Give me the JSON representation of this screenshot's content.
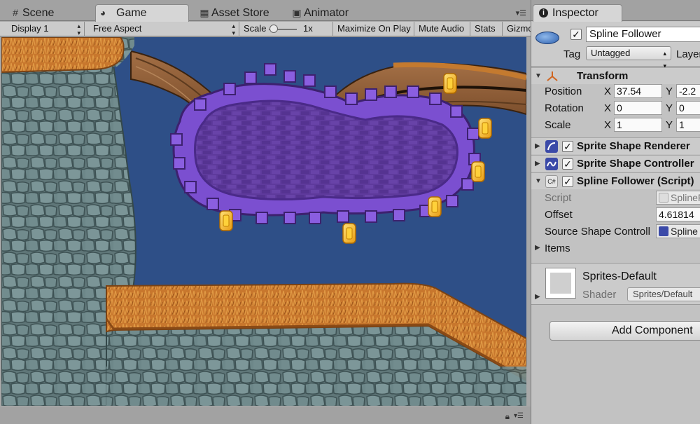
{
  "tabs": [
    {
      "label": "Scene",
      "icon": "grid-icon"
    },
    {
      "label": "Game",
      "icon": "pacman-icon"
    },
    {
      "label": "Asset Store",
      "icon": "store-icon"
    },
    {
      "label": "Animator",
      "icon": "animator-icon"
    }
  ],
  "toolbar": {
    "display": "Display 1",
    "aspect": "Free Aspect",
    "scale_label": "Scale",
    "scale_value": "1x",
    "maximize": "Maximize On Play",
    "mute": "Mute Audio",
    "stats": "Stats",
    "gizmos": "Gizmos"
  },
  "inspector": {
    "tab_label": "Inspector",
    "object_name": "Spline Follower",
    "tag_label": "Tag",
    "tag_value": "Untagged",
    "layer_label": "Layer",
    "transform": {
      "title": "Transform",
      "position_label": "Position",
      "position_x": "37.54",
      "position_y": "-2.2",
      "rotation_label": "Rotation",
      "rotation_x": "0",
      "rotation_y": "0",
      "scale_label": "Scale",
      "scale_x": "1",
      "scale_y": "1",
      "x_axis": "X",
      "y_axis": "Y"
    },
    "components": {
      "sprite_shape_renderer": "Sprite Shape Renderer",
      "sprite_shape_controller": "Sprite Shape Controller",
      "spline_follower_script": "Spline Follower (Script)"
    },
    "script_props": {
      "script_label": "Script",
      "script_value": "SplineFollower",
      "offset_label": "Offset",
      "offset_value": "4.61814",
      "source_label": "Source Shape Controll",
      "source_value": "Spline",
      "items_label": "Items"
    },
    "material": {
      "name": "Sprites-Default",
      "shader_label": "Shader",
      "shader_value": "Sprites/Default"
    },
    "add_component": "Add Component"
  },
  "colors": {
    "sky": "#2e4f87",
    "rock": "#6f8a8c",
    "grass": "#c8772d",
    "platform_purple": "#6a3fb4",
    "coin": "#f0b21e"
  }
}
